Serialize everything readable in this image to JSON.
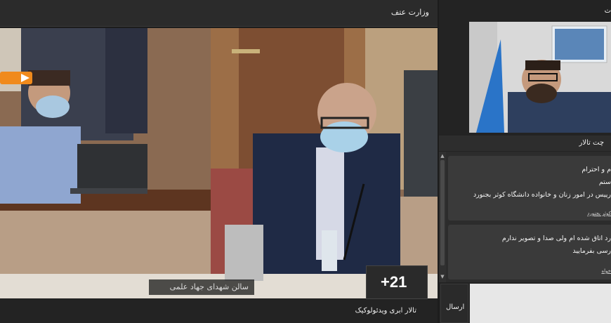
{
  "left_header": {
    "title": "وزارت عتف"
  },
  "video": {
    "caption": "سالن شهدای جهاد علمی",
    "participants_more": "+21",
    "logo_text": "ویدئو"
  },
  "bottom_bar": {
    "title": "تالار ابری ویدئولوکیک"
  },
  "right_panel": {
    "top_title": "ت",
    "chat_header": "چت تالار",
    "messages": [
      {
        "lines": [
          "م و احترام",
          "ستم",
          "رییس در امور زنان و خانواده دانشگاه کوثر بجنورد"
        ],
        "sender": "کوثر بجنورد"
      },
      {
        "lines": [
          "رد اتاق شده ام ولی صدا و تصویر ندارم",
          "رسی بفرمایید"
        ],
        "sender": "خواه"
      }
    ],
    "send_label": "ارسال",
    "send_placeholder": ""
  },
  "colors": {
    "panel_bg": "#232323",
    "header_bg": "#2b2b2b",
    "message_bg": "#3a3a3a",
    "input_bg": "#e7e7e7"
  },
  "icons": {
    "scroll_up": "triangle-up",
    "scroll_down": "triangle-down",
    "logo": "video-logo"
  }
}
